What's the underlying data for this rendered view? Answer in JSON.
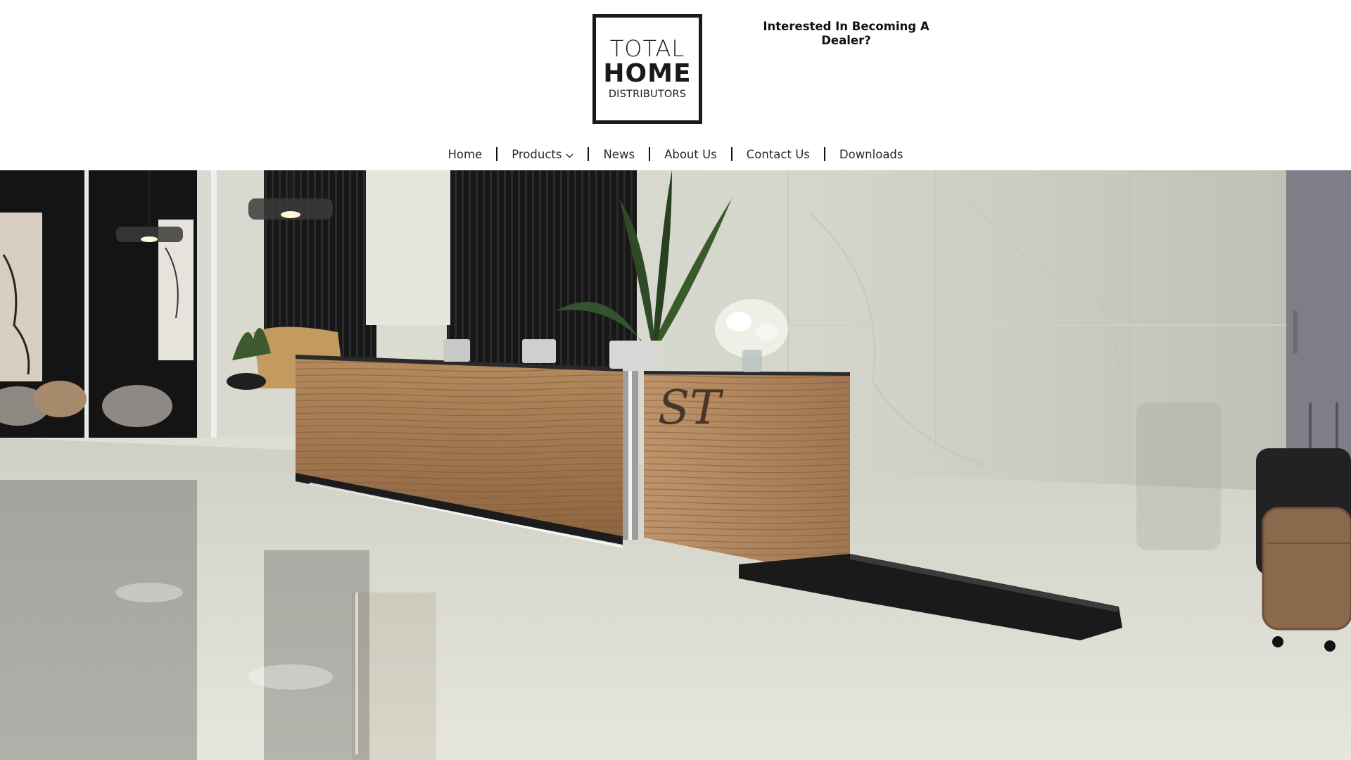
{
  "logo": {
    "line1": "TOTAL",
    "line2": "HOME",
    "line3": "DISTRIBUTORS"
  },
  "dealer_link": {
    "text": "Interested In Becoming A Dealer?"
  },
  "nav": {
    "items": [
      {
        "label": "Home"
      },
      {
        "label": "Products",
        "icon": "chevron-down-icon"
      },
      {
        "label": "News"
      },
      {
        "label": "About Us"
      },
      {
        "label": "Contact Us"
      },
      {
        "label": "Downloads"
      }
    ]
  },
  "hero": {
    "sign_text": "ST"
  },
  "colors": {
    "text": "#1a1a1a",
    "background": "#ffffff",
    "wood": "#a77a4e",
    "marble": "#d9dad0"
  }
}
